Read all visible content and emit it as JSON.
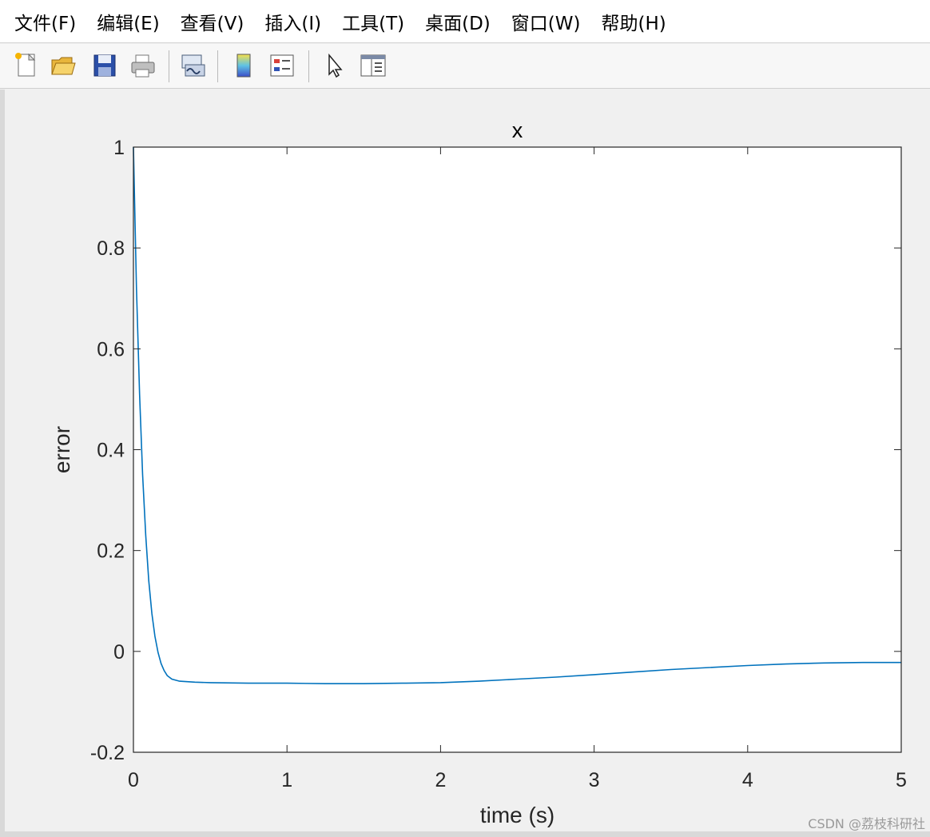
{
  "menubar": {
    "items": [
      "文件(F)",
      "编辑(E)",
      "查看(V)",
      "插入(I)",
      "工具(T)",
      "桌面(D)",
      "窗口(W)",
      "帮助(H)"
    ]
  },
  "toolbar": {
    "icons": [
      "new-figure-icon",
      "open-file-icon",
      "save-icon",
      "print-icon",
      "link-plot-icon",
      "colorbar-icon",
      "legend-icon",
      "pointer-icon",
      "property-inspector-icon"
    ]
  },
  "chart_data": {
    "type": "line",
    "title": "x",
    "xlabel": "time (s)",
    "ylabel": "error",
    "xlim": [
      0,
      5
    ],
    "ylim": [
      -0.2,
      1
    ],
    "xticks": [
      "0",
      "1",
      "2",
      "3",
      "4",
      "5"
    ],
    "yticks": [
      "-0.2",
      "0",
      "0.2",
      "0.4",
      "0.6",
      "0.8",
      "1"
    ],
    "grid": false,
    "series": [
      {
        "color": "#0072BD",
        "x": [
          0,
          0.02,
          0.04,
          0.06,
          0.08,
          0.1,
          0.12,
          0.14,
          0.16,
          0.18,
          0.2,
          0.22,
          0.25,
          0.3,
          0.4,
          0.5,
          0.75,
          1.0,
          1.25,
          1.5,
          1.75,
          2.0,
          2.25,
          2.5,
          2.75,
          3.0,
          3.25,
          3.5,
          3.75,
          4.0,
          4.25,
          4.5,
          4.75,
          5.0
        ],
        "y": [
          1.0,
          0.72,
          0.51,
          0.35,
          0.23,
          0.14,
          0.075,
          0.03,
          -0.002,
          -0.024,
          -0.038,
          -0.048,
          -0.055,
          -0.059,
          -0.061,
          -0.062,
          -0.063,
          -0.063,
          -0.064,
          -0.064,
          -0.063,
          -0.062,
          -0.059,
          -0.055,
          -0.051,
          -0.046,
          -0.041,
          -0.036,
          -0.032,
          -0.028,
          -0.025,
          -0.023,
          -0.022,
          -0.022
        ]
      }
    ]
  },
  "watermark": "CSDN @荔枝科研社"
}
